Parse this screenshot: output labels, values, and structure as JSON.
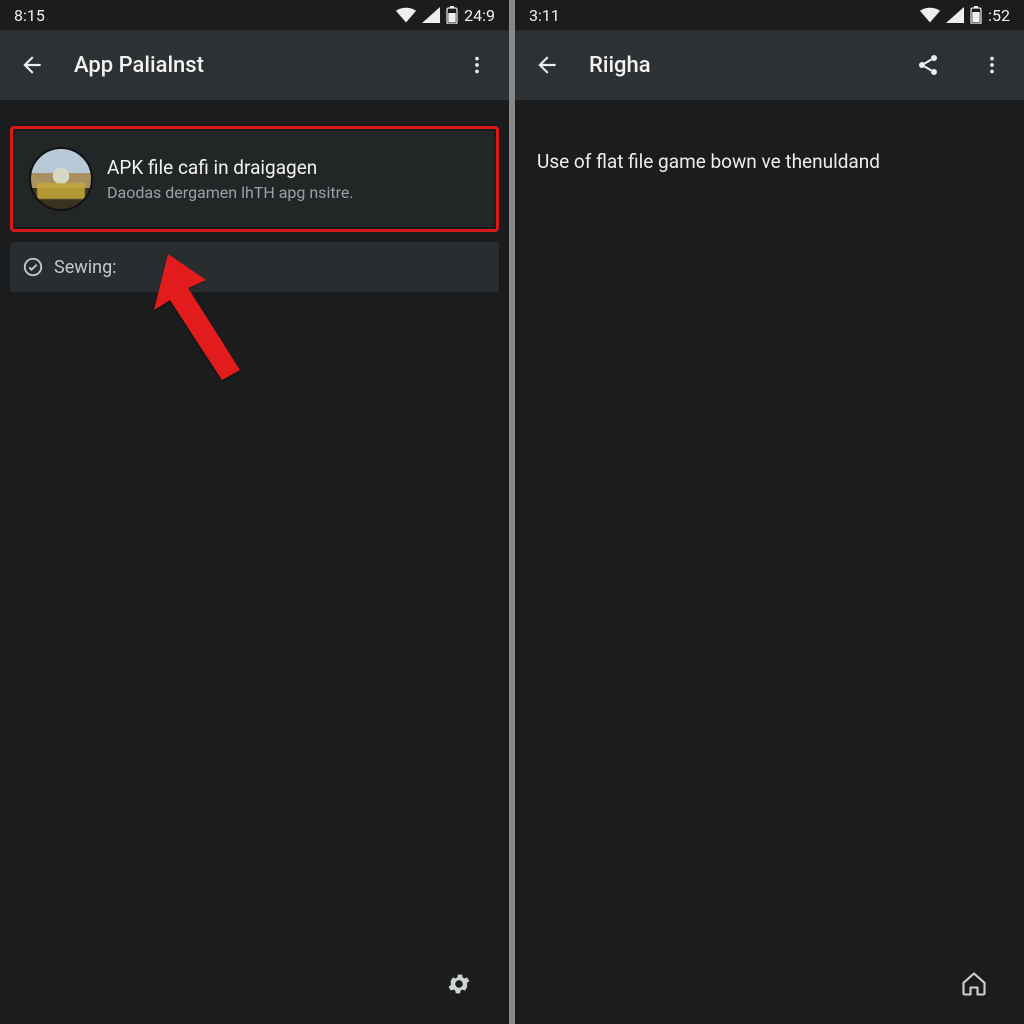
{
  "left": {
    "status": {
      "time": "8:15",
      "battery": "24:9"
    },
    "appbar": {
      "title": "App Palialnst"
    },
    "card": {
      "title": "APK file cafi in draigagen",
      "subtitle": "Daodas dergamen lhTH apg nsitre."
    },
    "sewing_label": "Sewing:"
  },
  "right": {
    "status": {
      "time": "3:11",
      "battery": ":52"
    },
    "appbar": {
      "title": "Riigha"
    },
    "body_text": "Use of flat file game bown ve thenuldand"
  }
}
